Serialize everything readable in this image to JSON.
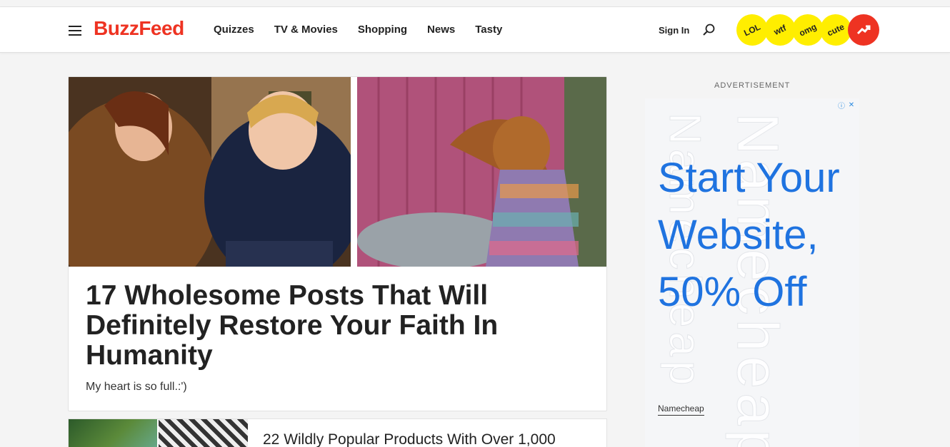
{
  "header": {
    "logo": "BuzzFeed",
    "nav": [
      "Quizzes",
      "TV & Movies",
      "Shopping",
      "News",
      "Tasty"
    ],
    "sign_in": "Sign In",
    "badges": [
      "LOL",
      "wtf",
      "omg",
      "cute"
    ],
    "accent_color": "#ee3322",
    "badge_color": "#ffee00"
  },
  "feature": {
    "title": "17 Wholesome Posts That Will Definitely Restore Your Faith In Humanity",
    "description": "My heart is so full.:')"
  },
  "second": {
    "title": "22 Wildly Popular Products With Over 1,000"
  },
  "ad": {
    "label": "ADVERTISEMENT",
    "headline": "Start Your Website, 50% Off",
    "brand": "Namecheap",
    "watermark_a": "Namecheap",
    "watermark_b": "Namecheap",
    "icon_info": "ⓘ",
    "icon_close": "✕"
  }
}
